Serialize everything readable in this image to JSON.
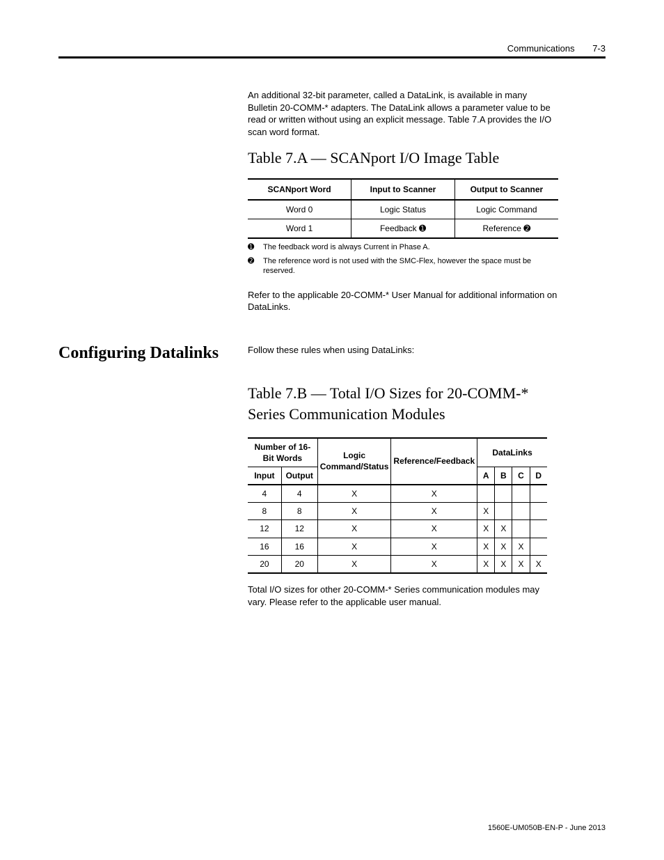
{
  "header": {
    "section": "Communications",
    "pageno": "7-3"
  },
  "intro_para": "An additional 32-bit parameter, called a DataLink, is available in many Bulletin 20-COMM-* adapters. The DataLink allows a parameter value to be read or written without using an explicit message. Table 7.A provides the I/O scan word format.",
  "table1": {
    "caption": "Table 7.A — SCANport I/O Image Table",
    "head": [
      "SCANport Word",
      "Input to Scanner",
      "Output to Scanner"
    ],
    "rows": [
      [
        "Word 0",
        "Logic Status",
        "Logic Command"
      ],
      [
        "Word 1",
        "Feedback ➊",
        "Reference ➋"
      ]
    ],
    "footnotes": [
      {
        "mark": "➊",
        "text": "The feedback word is always Current in Phase A."
      },
      {
        "mark": "➋",
        "text": "The reference word is not used with the SMC-Flex, however the space must be reserved."
      }
    ]
  },
  "para_after_t1": "Refer to the applicable 20-COMM-* User Manual for additional information on DataLinks.",
  "sect": {
    "head": "Configuring Datalinks",
    "text": "Follow these rules when using DataLinks:"
  },
  "table2_caption": "Table 7.B — Total I/O Sizes for 20-COMM-* Series Communication Modules",
  "table2": {
    "group_heads": {
      "words": "Number of 16-Bit Words",
      "lcs": "Logic Command/Status",
      "rf": "Reference/Feedback",
      "dl": "DataLinks"
    },
    "sub_heads": {
      "in": "Input",
      "out": "Output",
      "a": "A",
      "b": "B",
      "c": "C",
      "d": "D"
    }
  },
  "chart_data": {
    "type": "table",
    "title": "Total I/O Sizes for 20-COMM-* Series Communication Modules",
    "columns": [
      "Input",
      "Output",
      "Logic Command/Status",
      "Reference/Feedback",
      "A",
      "B",
      "C",
      "D"
    ],
    "rows": [
      {
        "Input": 4,
        "Output": 4,
        "Logic Command/Status": "X",
        "Reference/Feedback": "X",
        "A": "",
        "B": "",
        "C": "",
        "D": ""
      },
      {
        "Input": 8,
        "Output": 8,
        "Logic Command/Status": "X",
        "Reference/Feedback": "X",
        "A": "X",
        "B": "",
        "C": "",
        "D": ""
      },
      {
        "Input": 12,
        "Output": 12,
        "Logic Command/Status": "X",
        "Reference/Feedback": "X",
        "A": "X",
        "B": "X",
        "C": "",
        "D": ""
      },
      {
        "Input": 16,
        "Output": 16,
        "Logic Command/Status": "X",
        "Reference/Feedback": "X",
        "A": "X",
        "B": "X",
        "C": "X",
        "D": ""
      },
      {
        "Input": 20,
        "Output": 20,
        "Logic Command/Status": "X",
        "Reference/Feedback": "X",
        "A": "X",
        "B": "X",
        "C": "X",
        "D": "X"
      }
    ]
  },
  "after_t2": "Total I/O sizes for other 20-COMM-* Series communication modules may vary. Please refer to the applicable user manual.",
  "footer": "1560E-UM050B-EN-P - June 2013"
}
